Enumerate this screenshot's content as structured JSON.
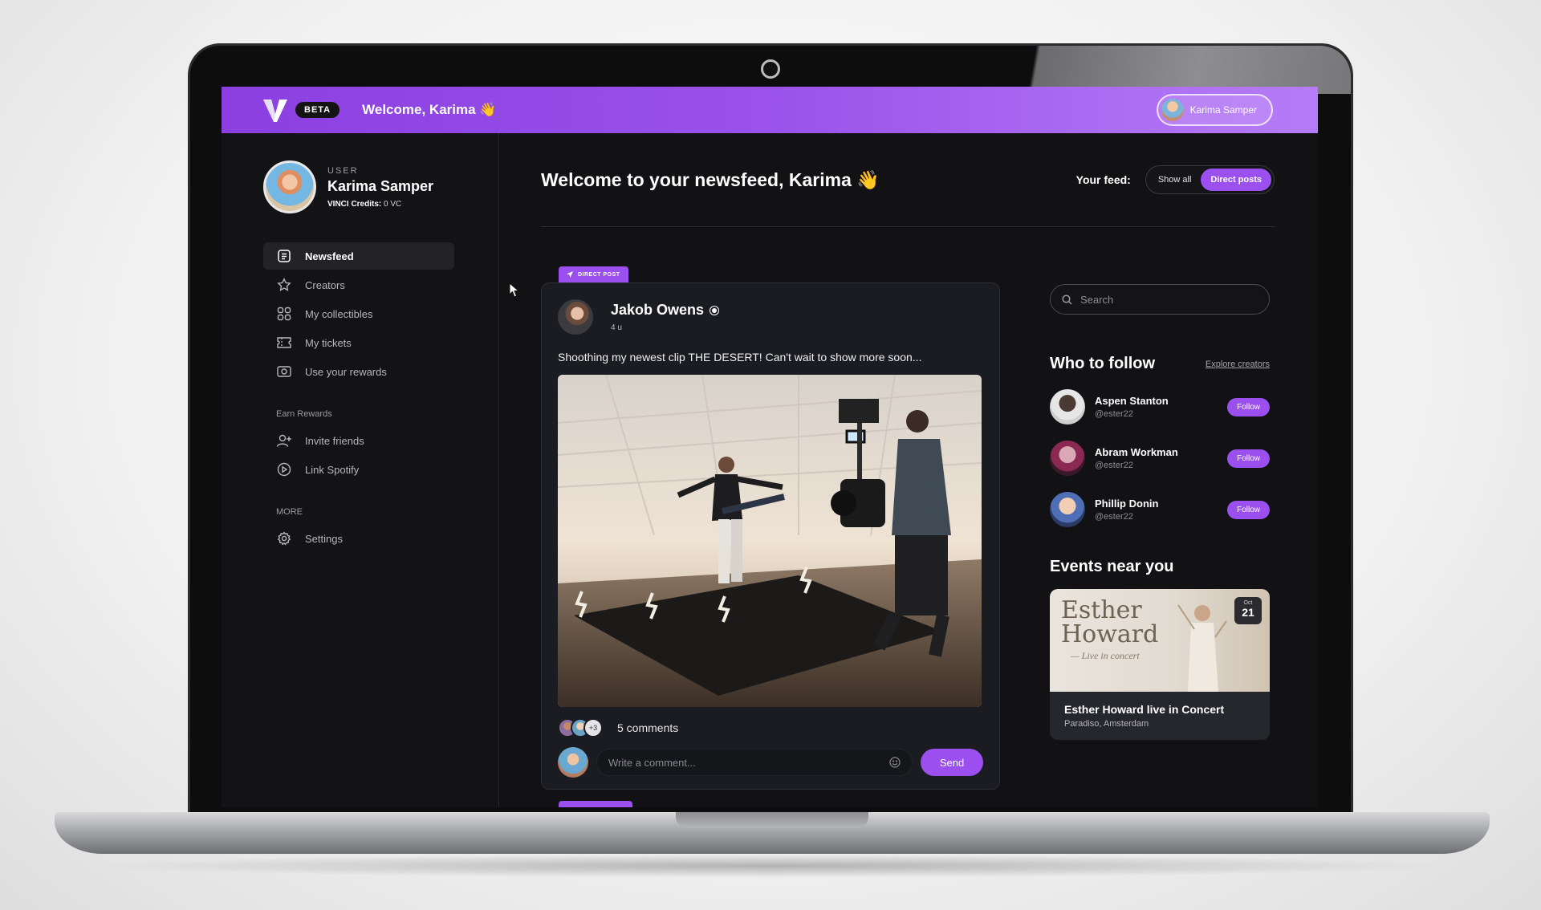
{
  "topbar": {
    "beta_label": "BETA",
    "welcome": "Welcome, Karima 👋",
    "user_pill_name": "Karima Samper"
  },
  "profile": {
    "role": "USER",
    "name": "Karima Samper",
    "credits_label": "VINCI Credits:",
    "credits_value": "0 VC"
  },
  "nav": {
    "items": [
      {
        "label": "Newsfeed",
        "icon": "newsfeed-icon",
        "active": true
      },
      {
        "label": "Creators",
        "icon": "star-icon"
      },
      {
        "label": "My collectibles",
        "icon": "grid-icon"
      },
      {
        "label": "My tickets",
        "icon": "ticket-icon"
      },
      {
        "label": "Use your rewards",
        "icon": "reward-icon"
      }
    ],
    "earn_section": "Earn Rewards",
    "earn_items": [
      {
        "label": "Invite friends",
        "icon": "add-user-icon"
      },
      {
        "label": "Link Spotify",
        "icon": "play-circle-icon"
      }
    ],
    "more_section": "MORE",
    "more_items": [
      {
        "label": "Settings",
        "icon": "gear-icon"
      }
    ]
  },
  "main": {
    "title": "Welcome to your newsfeed, Karima 👋",
    "feed_label": "Your feed:",
    "toggle": {
      "show_all": "Show all",
      "direct_posts": "Direct posts",
      "selected": "Direct posts"
    }
  },
  "post": {
    "tag": "DIRECT POST",
    "author": "Jakob Owens",
    "time": "4 u",
    "text": "Shoothing my newest clip THE DESERT! Can't wait to show more soon...",
    "comment_stack_more": "+3",
    "comments": "5 comments",
    "comment_placeholder": "Write a comment...",
    "send": "Send"
  },
  "right": {
    "search_placeholder": "Search",
    "who_to_follow": "Who to follow",
    "explore": "Explore creators",
    "follow_label": "Follow",
    "suggestions": [
      {
        "name": "Aspen Stanton",
        "handle": "@ester22"
      },
      {
        "name": "Abram Workman",
        "handle": "@ester22"
      },
      {
        "name": "Phillip Donin",
        "handle": "@ester22"
      }
    ],
    "events_title": "Events near you",
    "event": {
      "poster_line1": "Esther",
      "poster_line2": "Howard",
      "poster_sub": "— Live in concert",
      "month": "Oct",
      "day": "21",
      "name": "Esther Howard live in Concert",
      "place": "Paradiso, Amsterdam"
    }
  },
  "colors": {
    "accent": "#9c4fef",
    "background": "#121214",
    "card": "#1b1c21"
  }
}
